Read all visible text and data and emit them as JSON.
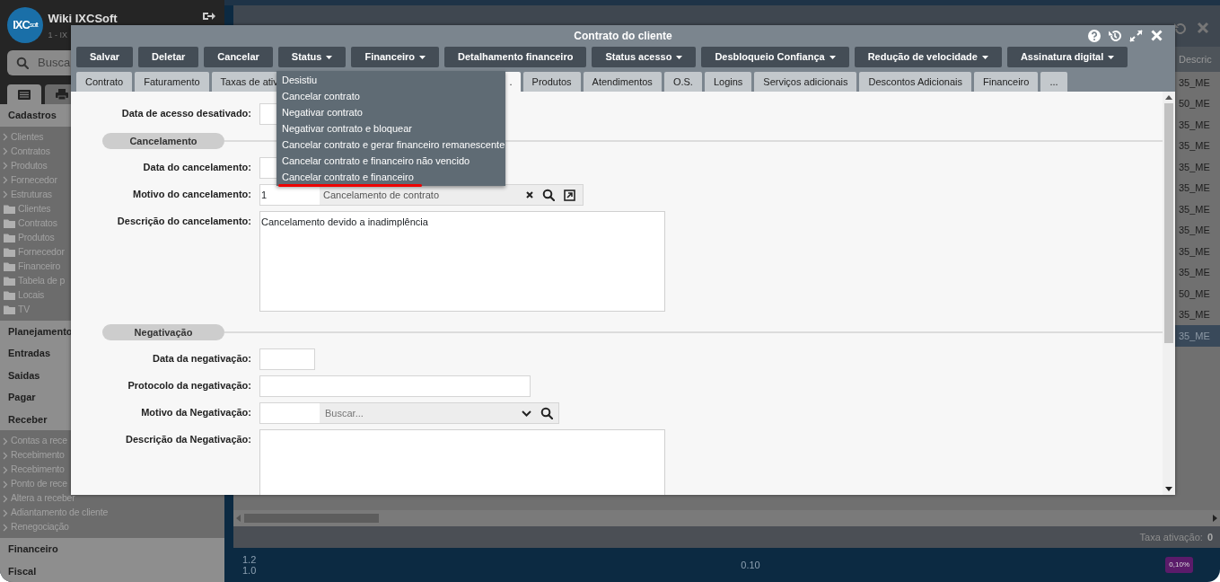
{
  "sidebar": {
    "logo": {
      "main": "IXC",
      "small": "soft"
    },
    "title": "Wiki IXCSoft",
    "subtitle": "1 - IX",
    "search": {
      "placeholder": "Busca"
    },
    "tabs": [
      {
        "selected": true
      },
      {
        "selected": false
      }
    ],
    "groups": [
      {
        "title": "Cadastros",
        "items": [
          {
            "kind": "link",
            "label": "Clientes"
          },
          {
            "kind": "link",
            "label": "Contratos"
          },
          {
            "kind": "link",
            "label": "Produtos"
          },
          {
            "kind": "link",
            "label": "Fornecedor"
          },
          {
            "kind": "link",
            "label": "Estruturas"
          },
          {
            "kind": "folder",
            "label": "Clientes"
          },
          {
            "kind": "folder",
            "label": "Contratos"
          },
          {
            "kind": "folder",
            "label": "Produtos"
          },
          {
            "kind": "folder",
            "label": "Fornecedor"
          },
          {
            "kind": "folder",
            "label": "Financeiro"
          },
          {
            "kind": "folder",
            "label": "Tabela de p"
          },
          {
            "kind": "folder",
            "label": "Locais"
          },
          {
            "kind": "folder",
            "label": "TV"
          }
        ]
      },
      {
        "title": "Planejamento"
      },
      {
        "title": "Entradas"
      },
      {
        "title": "Saidas"
      },
      {
        "title": "Pagar"
      },
      {
        "title": "Receber",
        "items": [
          {
            "kind": "link",
            "label": "Contas a rece"
          },
          {
            "kind": "link",
            "label": "Recebimento"
          },
          {
            "kind": "link",
            "label": "Recebimento"
          },
          {
            "kind": "link",
            "label": "Ponto de rece"
          },
          {
            "kind": "link",
            "label": "Altera a receber"
          },
          {
            "kind": "link",
            "label": "Adiantamento de cliente"
          },
          {
            "kind": "link",
            "label": "Renegociação"
          }
        ]
      },
      {
        "title": "Financeiro"
      },
      {
        "title": "Fiscal"
      }
    ]
  },
  "background_window": {
    "table": {
      "columns": [
        "Descric"
      ],
      "rows": [
        {
          "cell": "35_ME",
          "selected": false
        },
        {
          "cell": "50_ME",
          "selected": false
        },
        {
          "cell": "35_ME",
          "selected": false
        },
        {
          "cell": "35_ME",
          "selected": false
        },
        {
          "cell": "35_ME",
          "selected": false
        },
        {
          "cell": "35_ME",
          "selected": false
        },
        {
          "cell": "35_ME",
          "selected": false
        },
        {
          "cell": "35_ME",
          "selected": false
        },
        {
          "cell": "35_ME",
          "selected": false
        },
        {
          "cell": "35_ME",
          "selected": false
        },
        {
          "cell": "50_ME",
          "selected": false
        },
        {
          "cell": "35_ME",
          "selected": false
        },
        {
          "cell": "35_ME",
          "selected": true
        }
      ]
    },
    "footer": {
      "label": "Taxa ativação:",
      "value": "0"
    }
  },
  "dashboard": {
    "axis_labels": [
      "1.2",
      "1.0"
    ],
    "value": "0.10",
    "badge": "0,10%"
  },
  "modal": {
    "title": "Contrato do cliente",
    "toolbar": [
      {
        "label": "Salvar",
        "dropdown": false
      },
      {
        "label": "Deletar",
        "dropdown": false
      },
      {
        "label": "Cancelar",
        "dropdown": false
      },
      {
        "label": "Status",
        "dropdown": true,
        "menu": [
          {
            "label": "Desistiu",
            "marked": false
          },
          {
            "label": "Cancelar contrato",
            "marked": false
          },
          {
            "label": "Negativar contrato",
            "marked": false
          },
          {
            "label": "Negativar contrato e bloquear",
            "marked": false
          },
          {
            "label": "Cancelar contrato e gerar financeiro remanescente",
            "marked": false
          },
          {
            "label": "Cancelar contrato e financeiro não vencido",
            "marked": false
          },
          {
            "label": "Cancelar contrato e financeiro",
            "marked": true
          }
        ]
      },
      {
        "label": "Financeiro",
        "dropdown": true
      },
      {
        "label": "Detalhamento financeiro",
        "dropdown": false
      },
      {
        "label": "Status acesso",
        "dropdown": true
      },
      {
        "label": "Desbloqueio Confiança",
        "dropdown": true
      },
      {
        "label": "Redução de velocidade",
        "dropdown": true
      },
      {
        "label": "Assinatura digital",
        "dropdown": true
      }
    ],
    "tabs": [
      {
        "label": "Contrato",
        "selected": false
      },
      {
        "label": "Faturamento",
        "selected": false
      },
      {
        "label": "Taxas de ativ",
        "selected": false
      },
      {
        "label": ".",
        "selected": true
      },
      {
        "label": "Produtos",
        "selected": false
      },
      {
        "label": "Atendimentos",
        "selected": false
      },
      {
        "label": "O.S.",
        "selected": false
      },
      {
        "label": "Logins",
        "selected": false
      },
      {
        "label": "Serviços adicionais",
        "selected": false
      },
      {
        "label": "Descontos Adicionais",
        "selected": false
      },
      {
        "label": "Financeiro",
        "selected": false
      },
      {
        "label": "...",
        "selected": false
      }
    ],
    "form": [
      {
        "kind": "date",
        "label": "Data de acesso desativado:"
      },
      {
        "kind": "section",
        "title": "Cancelamento"
      },
      {
        "kind": "date",
        "label": "Data do cancelamento:"
      },
      {
        "kind": "lookup",
        "label": "Motivo do cancelamento:",
        "code": "1",
        "value": "Cancelamento de contrato"
      },
      {
        "kind": "textarea",
        "label": "Descrição do cancelamento:",
        "value": "Cancelamento devido a inadimplência"
      },
      {
        "kind": "section",
        "title": "Negativação"
      },
      {
        "kind": "date",
        "label": "Data da negativação:"
      },
      {
        "kind": "text",
        "label": "Protocolo da negativação:"
      },
      {
        "kind": "select",
        "label": "Motivo da Negativação:",
        "placeholder": "Buscar..."
      },
      {
        "kind": "textarea",
        "label": "Descrição da Negativação:"
      }
    ]
  }
}
